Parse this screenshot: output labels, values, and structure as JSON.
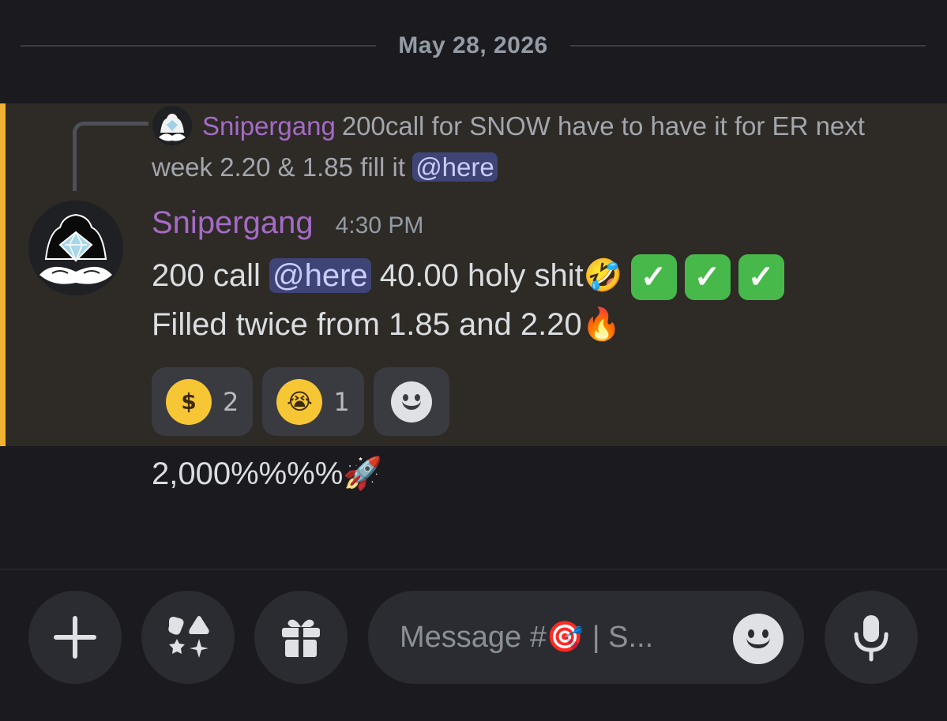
{
  "date_divider": "May 28, 2026",
  "reply": {
    "author": "Snipergang",
    "text_before": "200call for SNOW have to have it for ER next week 2.20 & 1.85 fill it ",
    "mention": "@here"
  },
  "message": {
    "author": "Snipergang",
    "timestamp": "4:30 PM",
    "line1_before": "200 call ",
    "mention": "@here",
    "line1_after": " 40.00 holy shit",
    "line1_emoji": "🤣",
    "check_glyph": "✓",
    "line2": "Filled twice from 1.85 and 2.20",
    "line2_emoji": "🔥"
  },
  "reactions": [
    {
      "emoji_name": "money-mouth-face",
      "emoji": "$",
      "count": "2"
    },
    {
      "emoji_name": "loudly-crying-face",
      "emoji": "😭",
      "count": "1"
    }
  ],
  "followup": {
    "text": "2,000%%%%",
    "emoji": "🚀"
  },
  "composer": {
    "placeholder": "Message #🎯 | S..."
  },
  "colors": {
    "background": "#1a1a1f",
    "highlight": "#2e2a26",
    "highlight_border": "#f0b232",
    "author": "#a56bc6",
    "mention_bg": "#3f4476",
    "check_green": "#46b94a"
  }
}
